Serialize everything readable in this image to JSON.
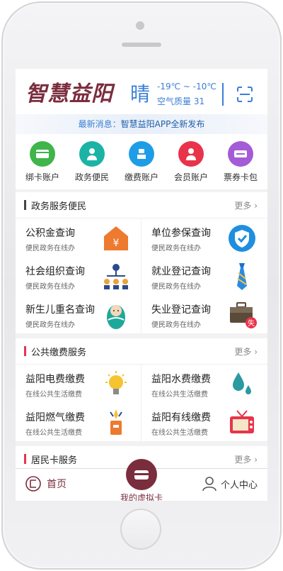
{
  "header": {
    "logo_text": "智慧益阳",
    "weather": "晴",
    "temperature": "-19℃ ~ -10℃",
    "air_quality": "空气质量  31"
  },
  "news": {
    "prefix": "最新消息：",
    "text": "智慧益阳APP全新发布"
  },
  "quick_actions": [
    {
      "label": "绑卡账户",
      "icon": "card-icon",
      "color": "#3fb54b"
    },
    {
      "label": "政务便民",
      "icon": "officer-icon",
      "color": "#1bb3a6"
    },
    {
      "label": "缴费账户",
      "icon": "payment-hand-icon",
      "color": "#1e9de6"
    },
    {
      "label": "会员账户",
      "icon": "member-icon",
      "color": "#e8334a"
    },
    {
      "label": "票券卡包",
      "icon": "ticket-icon",
      "color": "#a35bd6"
    }
  ],
  "sections": [
    {
      "title": "政务服务便民",
      "bar_color": "#444444",
      "more": "更多",
      "items": [
        {
          "title": "公积金查询",
          "subtitle": "便民政务在线办",
          "icon": "house-fund-icon"
        },
        {
          "title": "单位参保查询",
          "subtitle": "便民政务在线办",
          "icon": "shield-icon"
        },
        {
          "title": "社会组织查询",
          "subtitle": "便民政务在线办",
          "icon": "org-chart-icon"
        },
        {
          "title": "就业登记查询",
          "subtitle": "便民政务在线办",
          "icon": "tie-icon"
        },
        {
          "title": "新生儿重名查询",
          "subtitle": "便民政务在线办",
          "icon": "baby-icon"
        },
        {
          "title": "失业登记查询",
          "subtitle": "便民政务在线办",
          "icon": "briefcase-icon"
        }
      ]
    },
    {
      "title": "公共缴费服务",
      "bar_color": "#e8334a",
      "more": "更多",
      "items": [
        {
          "title": "益阳电费缴费",
          "subtitle": "在线公共生活缴费",
          "icon": "bulb-icon"
        },
        {
          "title": "益阳水费缴费",
          "subtitle": "在线公共生活缴费",
          "icon": "water-drop-icon"
        },
        {
          "title": "益阳燃气缴费",
          "subtitle": "在线公共生活缴费",
          "icon": "gas-icon"
        },
        {
          "title": "益阳有线缴费",
          "subtitle": "在线公共生活缴费",
          "icon": "tv-icon"
        }
      ]
    },
    {
      "title": "居民卡服务",
      "bar_color": "#e8334a",
      "more": "更多",
      "items": []
    }
  ],
  "bottom_nav": {
    "home": "首页",
    "card": "我的虚拟卡",
    "user": "个人中心"
  },
  "colors": {
    "brand": "#7a2d3d",
    "accent_blue": "#3a7fd5"
  }
}
